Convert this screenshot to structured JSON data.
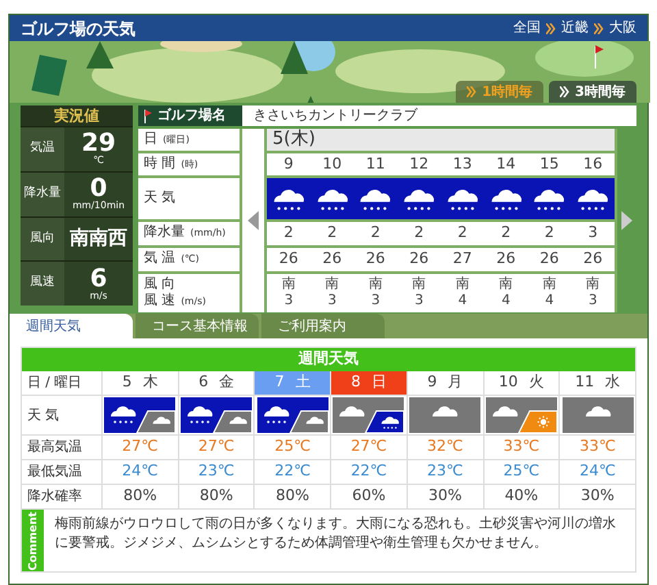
{
  "header": {
    "title": "ゴルフ場の天気",
    "breadcrumbs": [
      "全国",
      "近畿",
      "大阪"
    ]
  },
  "intervals": [
    {
      "label": "1時間毎",
      "selected": true
    },
    {
      "label": "3時間毎",
      "selected": false
    }
  ],
  "current": {
    "title": "実況値",
    "rows": [
      {
        "label": "気温",
        "value": "29",
        "unit": "℃"
      },
      {
        "label": "降水量",
        "value": "0",
        "unit": "mm/10min"
      },
      {
        "label": "風向",
        "value": "南南西"
      },
      {
        "label": "風速",
        "value": "6",
        "unit": "m/s"
      }
    ]
  },
  "course": {
    "label": "ゴルフ場名",
    "name": "きさいちカントリークラブ"
  },
  "hourly": {
    "row_labels": [
      {
        "main": "日",
        "sub": "(曜日)"
      },
      {
        "main": "時 間",
        "sub": "(時)"
      },
      {
        "main": "天 気"
      },
      {
        "main": "降水量",
        "sub": "(mm/h)"
      },
      {
        "main": "気 温",
        "sub": "(℃)"
      },
      {
        "main": "風 向",
        "main2": "風 速",
        "sub": "(m/s)"
      }
    ],
    "date": "5(木)",
    "hours": [
      {
        "hour": "9",
        "kind": "rain",
        "precip": "2",
        "temp": "26",
        "dir": "南",
        "speed": "3"
      },
      {
        "hour": "10",
        "kind": "rain",
        "precip": "2",
        "temp": "26",
        "dir": "南",
        "speed": "3"
      },
      {
        "hour": "11",
        "kind": "rain",
        "precip": "2",
        "temp": "26",
        "dir": "南",
        "speed": "3"
      },
      {
        "hour": "12",
        "kind": "rain",
        "precip": "2",
        "temp": "26",
        "dir": "南",
        "speed": "3"
      },
      {
        "hour": "13",
        "kind": "rain",
        "precip": "2",
        "temp": "27",
        "dir": "南",
        "speed": "4"
      },
      {
        "hour": "14",
        "kind": "rain",
        "precip": "2",
        "temp": "26",
        "dir": "南",
        "speed": "4"
      },
      {
        "hour": "15",
        "kind": "rain",
        "precip": "2",
        "temp": "26",
        "dir": "南",
        "speed": "4"
      },
      {
        "hour": "16",
        "kind": "rain",
        "precip": "3",
        "temp": "26",
        "dir": "南",
        "speed": "3"
      }
    ]
  },
  "tabs": [
    {
      "label": "週間天気",
      "selected": true
    },
    {
      "label": "コース基本情報",
      "selected": false
    },
    {
      "label": "ご利用案内",
      "selected": false
    }
  ],
  "weekly": {
    "title": "週間天気",
    "header_label": "日 / 曜日",
    "row_labels": [
      "天 気",
      "最高気温",
      "最低気温",
      "降水確率"
    ],
    "days": [
      {
        "day": "5",
        "weekday": "木",
        "kind": "weekday",
        "weather": [
          {
            "kind": "rain"
          },
          {
            "kind": "cloud"
          }
        ],
        "high": "27℃",
        "low": "24℃",
        "pop": "80%"
      },
      {
        "day": "6",
        "weekday": "金",
        "kind": "weekday",
        "weather": [
          {
            "kind": "rain"
          },
          {
            "kind": "cloud"
          }
        ],
        "high": "27℃",
        "low": "23℃",
        "pop": "80%"
      },
      {
        "day": "7",
        "weekday": "土",
        "kind": "saturday",
        "weather": [
          {
            "kind": "rain"
          },
          {
            "kind": "cloud"
          }
        ],
        "high": "25℃",
        "low": "22℃",
        "pop": "80%"
      },
      {
        "day": "8",
        "weekday": "日",
        "kind": "sunday",
        "weather": [
          {
            "kind": "cloud"
          },
          {
            "kind": "rain"
          }
        ],
        "high": "27℃",
        "low": "22℃",
        "pop": "60%"
      },
      {
        "day": "9",
        "weekday": "月",
        "kind": "weekday",
        "weather": [
          {
            "kind": "cloud"
          }
        ],
        "high": "32℃",
        "low": "23℃",
        "pop": "30%"
      },
      {
        "day": "10",
        "weekday": "火",
        "kind": "weekday",
        "weather": [
          {
            "kind": "cloud"
          },
          {
            "kind": "sun"
          }
        ],
        "high": "33℃",
        "low": "25℃",
        "pop": "40%"
      },
      {
        "day": "11",
        "weekday": "水",
        "kind": "weekday",
        "weather": [
          {
            "kind": "cloud"
          }
        ],
        "high": "33℃",
        "low": "24℃",
        "pop": "30%"
      }
    ],
    "comment_label": "Comment",
    "comment": "梅雨前線がウロウロして雨の日が多くなります。大雨になる恐れも。土砂災害や河川の増水に要警戒。ジメジメ、ムシムシとするため体調管理や衛生管理も欠かせません。"
  }
}
